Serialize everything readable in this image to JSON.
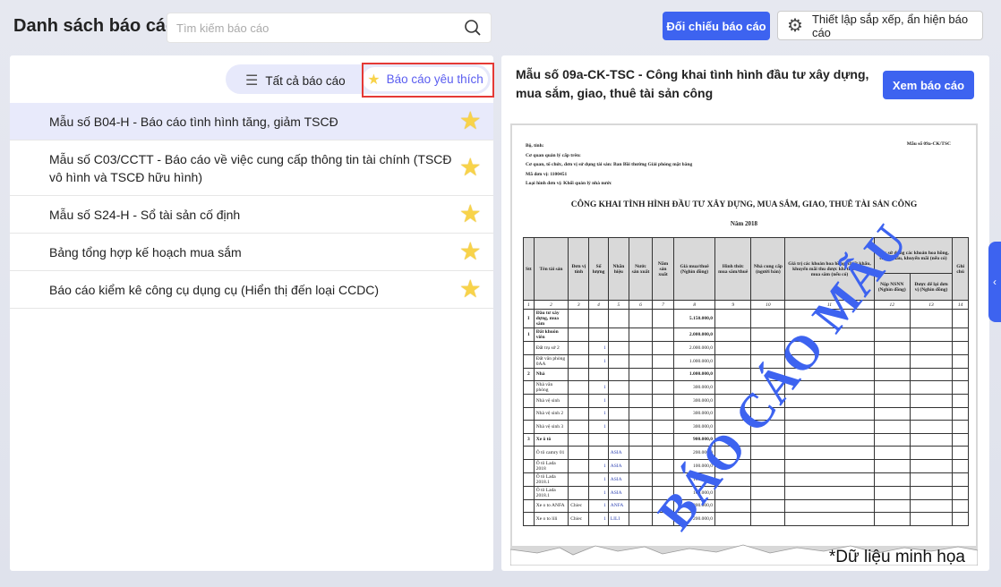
{
  "header": {
    "title": "Danh sách báo cáo",
    "search_placeholder": "Tìm kiếm báo cáo",
    "compare_label": "Đối chiếu báo cáo",
    "settings_label": "Thiết lập sắp xếp, ẩn hiện báo cáo"
  },
  "tabs": {
    "all": "Tất cả báo cáo",
    "favorite": "Báo cáo yêu thích",
    "active": "favorite"
  },
  "reports": [
    {
      "label": "Mẫu số B04-H - Báo cáo tình hình tăng, giảm TSCĐ",
      "favorite": true
    },
    {
      "label": "Mẫu số C03/CCTT - Báo cáo về việc cung cấp thông tin tài chính (TSCĐ vô hình và TSCĐ hữu hình)",
      "favorite": true
    },
    {
      "label": "Mẫu số S24-H - Sổ tài sản cố định",
      "favorite": true
    },
    {
      "label": "Bảng tổng hợp kế hoạch mua sắm",
      "favorite": true
    },
    {
      "label": "Báo cáo kiểm kê công cụ dụng cụ (Hiển thị đến loại CCDC)",
      "favorite": true
    }
  ],
  "preview": {
    "title": "Mẫu số 09a-CK-TSC - Công khai tình hình đầu tư xây dựng, mua sắm, giao, thuê tài sản công",
    "view_label": "Xem báo cáo",
    "note": "*Dữ liệu minh họa",
    "watermark": "BÁO CÁO MẪU",
    "doc": {
      "meta": [
        "Bộ, tỉnh:",
        "Cơ quan quản lý cấp trên:",
        "Cơ quan, tổ chức, đơn vị sử dụng tài sản: Ban Bồi thường Giải phóng mặt bằng",
        "Mã đơn vị: 1100451",
        "Loại hình đơn vị: Khối quản lý nhà nước"
      ],
      "form_code": "Mẫu số 09a-CK/TSC",
      "title": "CÔNG KHAI TÌNH HÌNH ĐẦU TƯ XÂY DỰNG, MUA SẮM, GIAO, THUÊ TÀI SẢN CÔNG",
      "year": "Năm 2018",
      "headers": [
        "Stt",
        "Tên tài sản",
        "Đơn vị tính",
        "Số lượng",
        "Nhãn hiệu",
        "Nước sản xuất",
        "Năm sản xuất",
        "Giá mua/thuê (Nghìn đồng)",
        "Hình thức mua sắm/thuê",
        "Nhà cung cấp (người bán)",
        "Giá trị các khoản hoa hồng, chiết khấu, khuyến mãi thu được khi thực hiện mua sắm (nếu có)",
        "Việc sử dụng các khoản hoa hồng, chiết khấu, khuyến mãi (nếu có)",
        "Ghi chú"
      ],
      "subheaders": [
        "Nộp NSNN (Nghìn đồng)",
        "Được để lại đơn vị (Nghìn đồng)"
      ],
      "col_numbers": [
        "1",
        "2",
        "3",
        "4",
        "5",
        "6",
        "7",
        "8",
        "9",
        "10",
        "11",
        "12",
        "13",
        "14"
      ],
      "rows": [
        {
          "stt": "I",
          "name": "Đầu tư xây dựng, mua sắm",
          "unit": "",
          "qty": "",
          "brand": "",
          "price": "5.150.000,0",
          "bold": true
        },
        {
          "stt": "1",
          "name": "Đất khuôn viên",
          "unit": "",
          "qty": "",
          "brand": "",
          "price": "2.000.000,0",
          "bold": true
        },
        {
          "stt": "",
          "name": "Đất trụ sở 2",
          "unit": "",
          "qty": "1",
          "brand": "",
          "price": "2.000.000,0"
        },
        {
          "stt": "",
          "name": "Đất văn phòng 0AA",
          "unit": "",
          "qty": "1",
          "brand": "",
          "price": "1.000.000,0"
        },
        {
          "stt": "2",
          "name": "Nhà",
          "unit": "",
          "qty": "",
          "brand": "",
          "price": "1.000.000,0",
          "bold": true
        },
        {
          "stt": "",
          "name": "Nhà văn phòng",
          "unit": "",
          "qty": "1",
          "brand": "",
          "price": "300.000,0"
        },
        {
          "stt": "",
          "name": "Nhà vệ sinh",
          "unit": "",
          "qty": "1",
          "brand": "",
          "price": "300.000,0"
        },
        {
          "stt": "",
          "name": "Nhà vệ sinh 2",
          "unit": "",
          "qty": "1",
          "brand": "",
          "price": "300.000,0"
        },
        {
          "stt": "",
          "name": "Nhà vệ sinh 3",
          "unit": "",
          "qty": "1",
          "brand": "",
          "price": "300.000,0"
        },
        {
          "stt": "3",
          "name": "Xe ô tô",
          "unit": "",
          "qty": "",
          "brand": "",
          "price": "900.000,0",
          "bold": true
        },
        {
          "stt": "",
          "name": "Ô tô camry 01",
          "unit": "",
          "qty": "",
          "brand": "ASIA",
          "price": "200.000,0"
        },
        {
          "stt": "",
          "name": "Ô tô Lada 2018",
          "unit": "",
          "qty": "1",
          "brand": "ASIA",
          "price": "100.000,0"
        },
        {
          "stt": "",
          "name": "Ô tô Lada 2018.1",
          "unit": "",
          "qty": "1",
          "brand": "ASIA",
          "price": "100.000,0"
        },
        {
          "stt": "",
          "name": "Ô tô Lada 2018.1",
          "unit": "",
          "qty": "1",
          "brand": "ASIA",
          "price": "100.000,0"
        },
        {
          "stt": "",
          "name": "Xe o to ANFA",
          "unit": "Chiec",
          "qty": "1",
          "brand": "ANFA",
          "price": "200.000,0"
        },
        {
          "stt": "",
          "name": "Xe o to lili",
          "unit": "Chiec",
          "qty": "1",
          "brand": "LILI",
          "price": "200.000,0"
        }
      ]
    }
  },
  "colors": {
    "primary": "#3d63f0",
    "favorite_star": "#f8d34a",
    "highlight_box": "#e53935",
    "active_row": "#e8eafb"
  }
}
